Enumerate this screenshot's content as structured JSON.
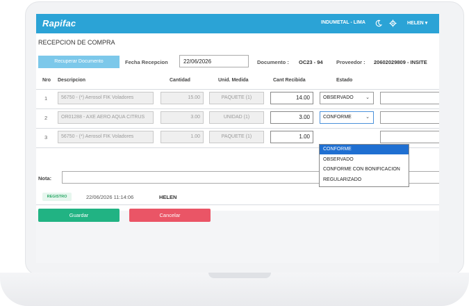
{
  "app": {
    "logo": "Rapifac",
    "company": "INDUMETAL - LIMA",
    "user": "HELEN"
  },
  "page": {
    "title": "RECEPCION DE COMPRA"
  },
  "form": {
    "recover_button": "Recuperar Documento",
    "date_label": "Fecha Recepcion",
    "date_value": "22/06/2026",
    "document_label": "Documento :",
    "document_value": "OC23 - 94",
    "provider_label": "Proveedor :",
    "provider_value": "20602029809 - INSITE"
  },
  "table": {
    "headers": {
      "nro": "Nro",
      "descripcion": "Descripcion",
      "cantidad": "Cantidad",
      "unidad": "Unid. Medida",
      "cant_recibida": "Cant Recibida",
      "estado": "Estado"
    },
    "rows": [
      {
        "nro": "1",
        "descripcion": "56750 - (*) Aerosol FIK Voladores",
        "cantidad": "15.00",
        "unidad": "PAQUETE (1)",
        "cant_recibida": "14.00",
        "estado": "OBSERVADO"
      },
      {
        "nro": "2",
        "descripcion": "OR01288 - AXE AERO AQUA CITRUS",
        "cantidad": "3.00",
        "unidad": "UNIDAD (1)",
        "cant_recibida": "3.00",
        "estado": "CONFORME"
      },
      {
        "nro": "3",
        "descripcion": "56750 - (*) Aerosol FIK Voladores",
        "cantidad": "1.00",
        "unidad": "PAQUETE (1)",
        "cant_recibida": "1.00",
        "estado": ""
      }
    ]
  },
  "dropdown": {
    "options": [
      "CONFORME",
      "OBSERVADO",
      "CONFORME CON BONIFICACION",
      "REGULARIZADO"
    ],
    "selected": "CONFORME"
  },
  "nota": {
    "label": "Nota:"
  },
  "record": {
    "badge": "REGISTRO",
    "datetime": "22/06/2026 11:14:06",
    "user": "HELEN"
  },
  "actions": {
    "save": "Guardar",
    "cancel": "Cancelar"
  },
  "icons": {
    "chevron": "⌄",
    "user_chevron": "▾"
  },
  "colors": {
    "header": "#2ba3d6",
    "save": "#21b383",
    "cancel": "#ea5566",
    "recover": "#7cc8ea",
    "selected_option": "#1f6fd1"
  }
}
